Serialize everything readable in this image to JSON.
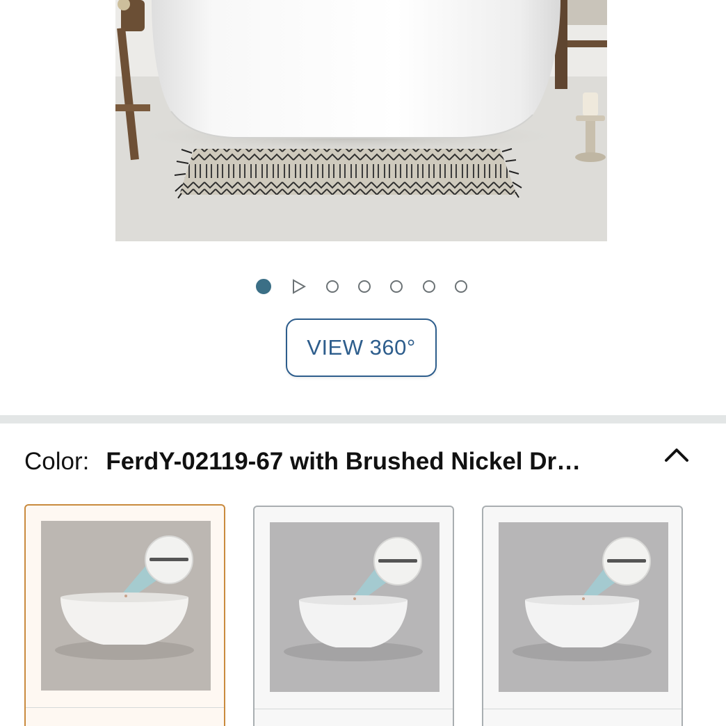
{
  "carousel": {
    "total_slides": 7,
    "active_index": 0,
    "video_slide_index": 1
  },
  "view360": {
    "label": "VIEW 360°"
  },
  "color": {
    "label": "Color:",
    "selected_value": "FerdY-02119-67 with Brushed Nickel Dr…"
  },
  "swatches": [
    {
      "selected": true
    },
    {
      "selected": false
    },
    {
      "selected": false
    }
  ],
  "colors": {
    "accent_link": "#2d5d8c",
    "active_dot": "#3b6f86",
    "selected_swatch_border": "#c98a3d",
    "swatch_border": "#a9aeb1"
  }
}
